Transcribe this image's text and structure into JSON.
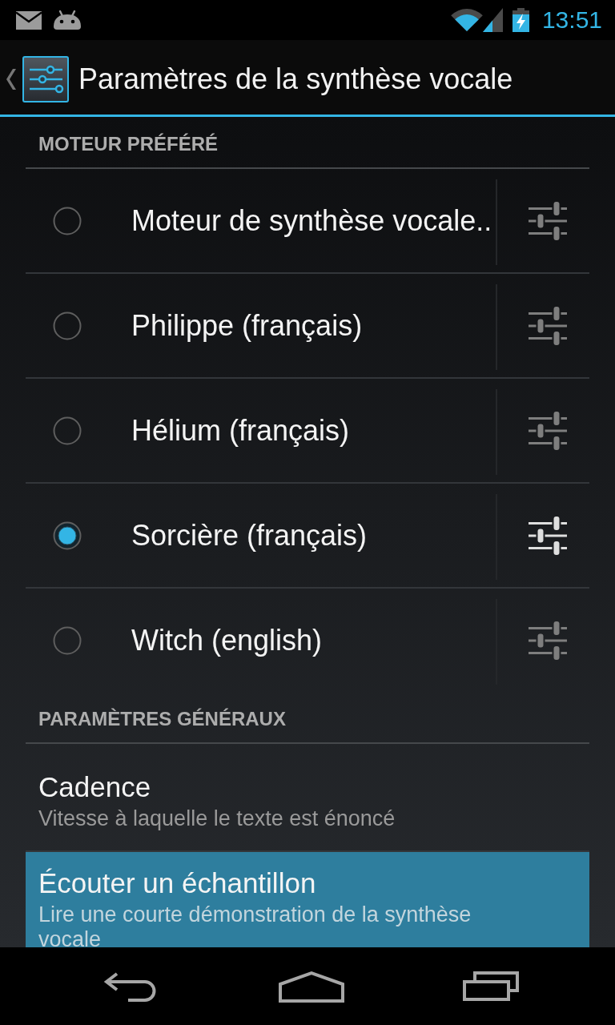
{
  "status_bar": {
    "time": "13:51"
  },
  "action_bar": {
    "title": "Paramètres de la synthèse vocale"
  },
  "sections": [
    {
      "header": "MOTEUR PRÉFÉRÉ",
      "items": [
        {
          "kind": "engine",
          "label": "Moteur de synthèse vocale..",
          "selected": false
        },
        {
          "kind": "engine",
          "label": "Philippe (français)",
          "selected": false
        },
        {
          "kind": "engine",
          "label": "Hélium (français)",
          "selected": false
        },
        {
          "kind": "engine",
          "label": "Sorcière (français)",
          "selected": true
        },
        {
          "kind": "engine",
          "label": "Witch (english)",
          "selected": false
        }
      ]
    },
    {
      "header": "PARAMÈTRES GÉNÉRAUX",
      "items": [
        {
          "kind": "preference",
          "title": "Cadence",
          "summary": "Vitesse à laquelle le texte est énoncé",
          "pressed": false
        },
        {
          "kind": "preference",
          "title": "Écouter un échantillon",
          "summary": "Lire une courte démonstration de la synthèse vocale",
          "pressed": true
        }
      ]
    }
  ]
}
